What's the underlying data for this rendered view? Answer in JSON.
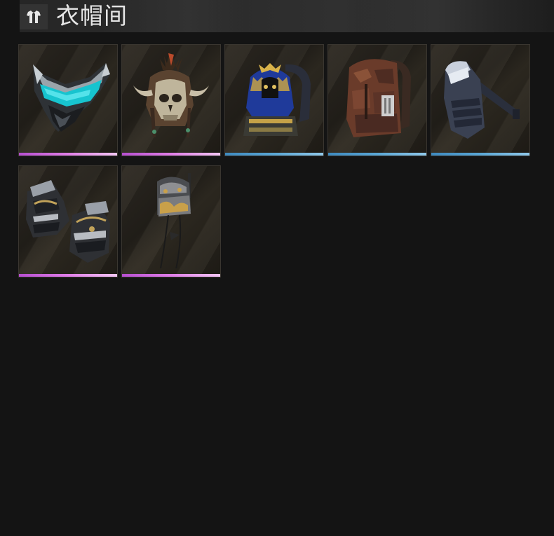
{
  "header": {
    "title": "衣帽间",
    "icon": "wardrobe-shirt-icon"
  },
  "colors": {
    "rarity_purple": "#d46ce0",
    "rarity_blue": "#5aa7d6",
    "background": "#141414"
  },
  "items": [
    {
      "name": "cyber-visor-helmet",
      "rarity": "purple"
    },
    {
      "name": "horned-skull-helmet",
      "rarity": "purple"
    },
    {
      "name": "pharaoh-backpack",
      "rarity": "blue"
    },
    {
      "name": "brown-camo-backpack",
      "rarity": "blue"
    },
    {
      "name": "sling-chest-bag",
      "rarity": "blue"
    },
    {
      "name": "armored-gauntlets",
      "rarity": "purple"
    },
    {
      "name": "ornate-helmet",
      "rarity": "purple"
    }
  ]
}
